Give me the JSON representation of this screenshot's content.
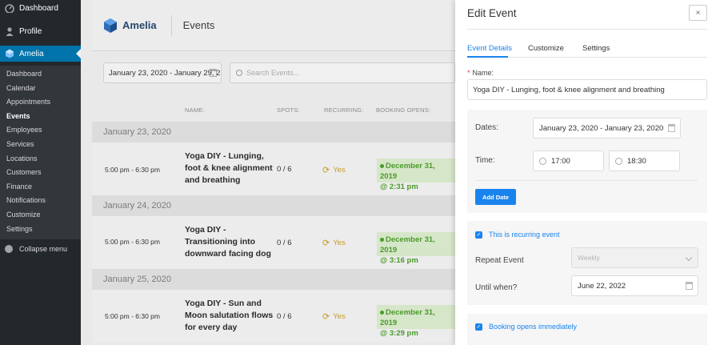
{
  "wp_menu": {
    "dashboard": "Dashboard",
    "profile": "Profile",
    "amelia": "Amelia",
    "submenu": [
      "Dashboard",
      "Calendar",
      "Appointments",
      "Events",
      "Employees",
      "Services",
      "Locations",
      "Customers",
      "Finance",
      "Notifications",
      "Customize",
      "Settings"
    ],
    "active_item": "Events",
    "collapse": "Collapse menu"
  },
  "header": {
    "brand": "Amelia",
    "title": "Events"
  },
  "filters": {
    "date_range": "January 23, 2020 - January 29, 2",
    "search_placeholder": "Search Events..."
  },
  "table": {
    "columns": {
      "name": "NAME:",
      "spots": "SPOTS:",
      "recurring": "RECURRING:",
      "booking": "BOOKING OPENS:"
    },
    "groups": [
      {
        "date": "January 23, 2020",
        "event": {
          "time": "5:00 pm - 6:30 pm",
          "name": "Yoga DIY - Lunging, foot & knee alignment and breathing",
          "spots": "0 / 6",
          "recurring": "Yes",
          "booking_date": "December 31, 2019",
          "booking_time": "@ 2:31 pm"
        }
      },
      {
        "date": "January 24, 2020",
        "event": {
          "time": "5:00 pm - 6:30 pm",
          "name": "Yoga DIY - Transitioning into downward facing dog",
          "spots": "0 / 6",
          "recurring": "Yes",
          "booking_date": "December 31, 2019",
          "booking_time": "@ 3:16 pm"
        }
      },
      {
        "date": "January 25, 2020",
        "event": {
          "time": "5:00 pm - 6:30 pm",
          "name": "Yoga DIY - Sun and Moon salutation flows for every day",
          "spots": "0 / 6",
          "recurring": "Yes",
          "booking_date": "December 31, 2019",
          "booking_time": "@ 3:29 pm"
        }
      }
    ]
  },
  "panel": {
    "title": "Edit Event",
    "close": "×",
    "tabs": [
      "Event Details",
      "Customize",
      "Settings"
    ],
    "name_label": "Name:",
    "name_required": "*",
    "name_value": "Yoga DIY - Lunging, foot & knee alignment and breathing",
    "dates_label": "Dates:",
    "dates_value": "January 23, 2020 - January 23, 2020",
    "time_label": "Time:",
    "time_start": "17:00",
    "time_end": "18:30",
    "add_date": "Add Date",
    "recurring_label": "This is recurring event",
    "repeat_label": "Repeat Event",
    "repeat_value": "Weekly",
    "until_label": "Until when?",
    "until_value": "June 22, 2022",
    "booking_immediately": "Booking opens immediately"
  },
  "colors": {
    "accent": "#1a84ee",
    "wp_sidebar": "#23282d",
    "wp_active": "#0073aa",
    "booking_green": "#4a9a2a",
    "recurring_gold": "#c89a20"
  }
}
